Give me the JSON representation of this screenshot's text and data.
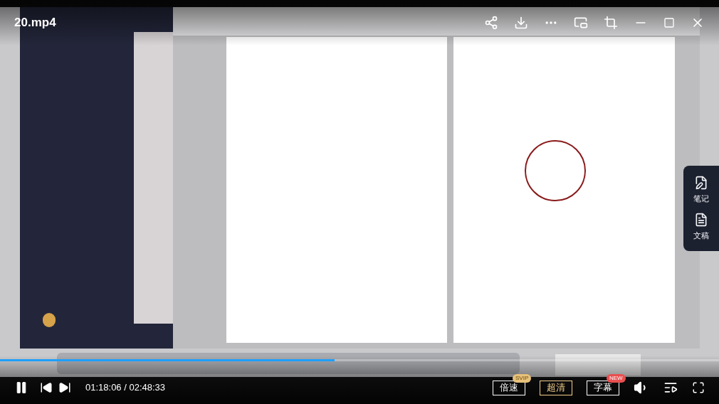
{
  "title": "20.mp4",
  "side_panel": [
    {
      "label": "笔记",
      "kind": "note"
    },
    {
      "label": "文稿",
      "kind": "doc"
    }
  ],
  "progress": {
    "level": 0.465
  },
  "controls": {
    "time": "01:18:06 / 02:48:33",
    "playing": true
  },
  "options": [
    {
      "label": "倍速",
      "badge": "SVIP",
      "selected": false
    },
    {
      "label": "超清",
      "selected": true
    },
    {
      "label": "字幕",
      "badge": "NEW",
      "selected": false
    }
  ]
}
